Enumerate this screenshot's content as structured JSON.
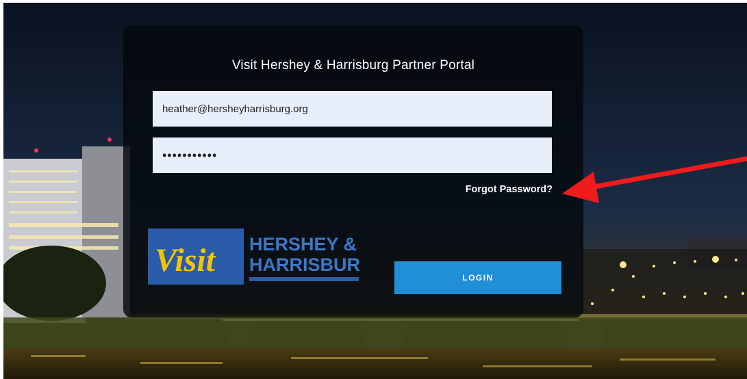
{
  "portal": {
    "title": "Visit Hershey & Harrisburg Partner Portal",
    "email_value": "heather@hersheyharrisburg.org",
    "password_value": "•••••••••••",
    "forgot_label": "Forgot Password?",
    "login_label": "LOGIN"
  },
  "logo": {
    "visit": "Visit",
    "line1": "HERSHEY &",
    "line2": "HARRISBURG"
  },
  "colors": {
    "accent_blue": "#1f8fd6",
    "logo_blue": "#2a5caa",
    "logo_yellow": "#f5c400",
    "annotation_red": "#ee1c1c"
  }
}
